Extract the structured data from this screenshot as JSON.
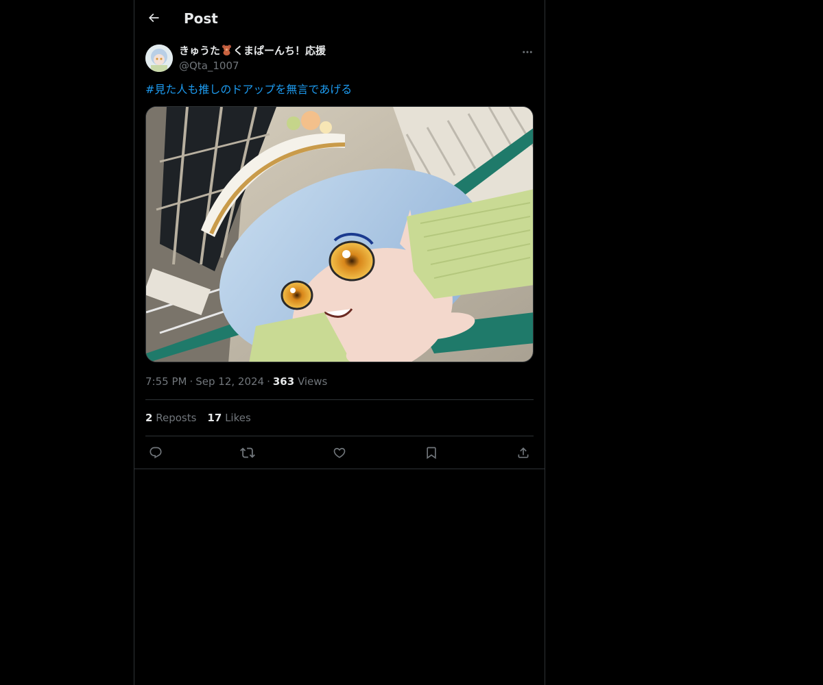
{
  "header": {
    "title": "Post",
    "back_icon": "arrow-left-icon"
  },
  "post": {
    "author": {
      "display_name_part1": "きゅうた",
      "display_name_emoji": "teddy-bear-emoji",
      "display_name_part2": "くまぱーんち！応援",
      "handle": "@Qta_1007"
    },
    "text": "#見た人も推しのドアップを無言であげる",
    "media_description_icon": "photo",
    "time": "7:55 PM",
    "date": "Sep 12, 2024",
    "views_count": "363",
    "views_label": "Views",
    "reposts_count": "2",
    "reposts_label": "Reposts",
    "likes_count": "17",
    "likes_label": "Likes",
    "separator": "·"
  },
  "actions": [
    {
      "name": "reply",
      "icon": "reply-icon"
    },
    {
      "name": "repost",
      "icon": "repost-icon"
    },
    {
      "name": "like",
      "icon": "heart-icon"
    },
    {
      "name": "bookmark",
      "icon": "bookmark-icon"
    },
    {
      "name": "share",
      "icon": "share-icon"
    }
  ],
  "colors": {
    "background": "#000000",
    "text": "#e7e9ea",
    "secondary": "#71767b",
    "accent": "#1d9bf0",
    "border": "#2f3336"
  }
}
